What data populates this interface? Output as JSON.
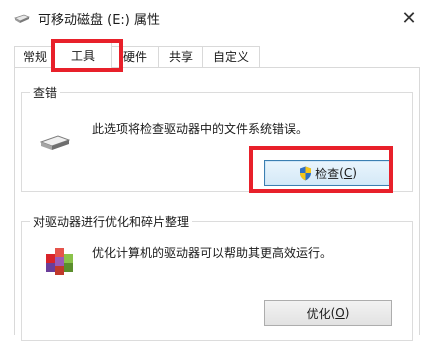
{
  "window": {
    "title": "可移动磁盘 (E:) 属性",
    "close_glyph": "✕"
  },
  "tabs": [
    {
      "label": "常规",
      "active": false
    },
    {
      "label": "工具",
      "active": true
    },
    {
      "label": "硬件",
      "active": false
    },
    {
      "label": "共享",
      "active": false
    },
    {
      "label": "自定义",
      "active": false
    }
  ],
  "error_check": {
    "group_title": "查错",
    "description": "此选项将检查驱动器中的文件系统错误。",
    "button_label": "检查",
    "button_key": "C",
    "button_icon": "shield-icon"
  },
  "optimize": {
    "group_title": "对驱动器进行优化和碎片整理",
    "description": "优化计算机的驱动器可以帮助其更高效运行。",
    "button_label": "优化",
    "button_key": "O",
    "icon": "defrag-icon"
  },
  "colors": {
    "highlight": "#e8202a",
    "focus_border": "#3c7fb1"
  }
}
